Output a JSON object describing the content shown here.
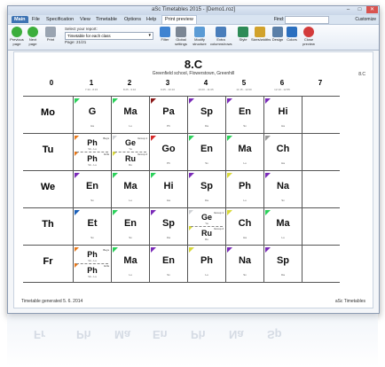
{
  "window": {
    "title": "aSc Timetables 2015 - [Demo1.roz]",
    "controls": [
      "–",
      "□",
      "✕"
    ]
  },
  "menu": {
    "items": [
      "Main",
      "File",
      "Specification",
      "View",
      "Timetable",
      "Options",
      "Help"
    ],
    "active_tab": "Print preview",
    "find_label": "Find:",
    "customize": "Customize"
  },
  "ribbon": {
    "previous": "Previous page",
    "next": "Next page",
    "print": "Print",
    "report_label": "Select your report:",
    "report_value": "Timetable for each class",
    "page_info": "Page: 21/21",
    "filter": "Filter",
    "global_settings": "Global settings",
    "modify_structure": "Modify structure",
    "extra_rows": "Extra columns/rows",
    "style": "Style",
    "sizes": "Sizes/widths",
    "design": "Design",
    "colors": "Colors",
    "close": "Close preview"
  },
  "timetable": {
    "class_name": "8.C",
    "school": "Greenfield school, Flowerstown, Greenhill",
    "right_label": "8.C",
    "periods": [
      "0",
      "1",
      "2",
      "3",
      "4",
      "5",
      "6",
      "7"
    ],
    "period_times": [
      "",
      "7:30 - 8:15",
      "8:25 - 9:10",
      "9:25 - 10:10",
      "10:20 - 11:05",
      "11:15 - 12:00",
      "12:10 - 12:55",
      ""
    ],
    "days": [
      {
        "name": "Mo",
        "cells": [
          {
            "subj": "G",
            "room": "Ha",
            "color": "#2bd15a"
          },
          {
            "subj": "Ma",
            "room": "Lu",
            "color": "#2bd15a"
          },
          {
            "subj": "Pa",
            "room": "Ph",
            "color": "#8b1a1a"
          },
          {
            "subj": "Sp",
            "room": "Da",
            "color": "#7a2ab8"
          },
          {
            "subj": "En",
            "room": "Sv",
            "color": "#7a2ab8"
          },
          {
            "subj": "Hi",
            "room": "Ha",
            "color": "#7a2ab8"
          }
        ]
      },
      {
        "name": "Tu",
        "cells": [
          {
            "split": true,
            "top": {
              "subj": "Ph",
              "room": "Vk - Lu",
              "group": "Boys",
              "color": "#e8781a"
            },
            "bottom": {
              "subj": "Ph",
              "room": "Vk - Lu",
              "group": "Girls",
              "color": "#e8781a"
            }
          },
          {
            "split": true,
            "top": {
              "subj": "Ge",
              "room": "Ya",
              "group": "Group 1",
              "color": "#cfd2d6"
            },
            "bottom": {
              "subj": "Ru",
              "room": "Ru",
              "group": "Group 2",
              "color": "#d9d93a"
            }
          },
          {
            "subj": "Go",
            "room": "Ph",
            "color": "#d62a2a"
          },
          {
            "subj": "En",
            "room": "Sv",
            "color": "#2bd15a"
          },
          {
            "subj": "Ma",
            "room": "Lu",
            "color": "#2bd15a"
          },
          {
            "subj": "Ch",
            "room": "Ha",
            "color": "#9a9a9a"
          }
        ]
      },
      {
        "name": "We",
        "cells": [
          {
            "subj": "En",
            "room": "Sv",
            "color": "#7a2ab8"
          },
          {
            "subj": "Ma",
            "room": "Lu",
            "color": "#2bd15a"
          },
          {
            "subj": "Hi",
            "room": "Ha",
            "color": "#2bd15a"
          },
          {
            "subj": "Sp",
            "room": "Da",
            "color": "#7a2ab8"
          },
          {
            "subj": "Ph",
            "room": "Lu",
            "color": "#d9d93a"
          },
          {
            "subj": "Na",
            "room": "Sv",
            "color": "#7a2ab8"
          }
        ]
      },
      {
        "name": "Th",
        "cells": [
          {
            "subj": "Et",
            "room": "Sv",
            "color": "#1a5fb8"
          },
          {
            "subj": "En",
            "room": "Sv",
            "color": "#2bd15a"
          },
          {
            "subj": "Sp",
            "room": "Da",
            "color": "#7a2ab8"
          },
          {
            "split": true,
            "top": {
              "subj": "Ge",
              "room": "Ya",
              "group": "Group 1",
              "color": "#cfd2d6"
            },
            "bottom": {
              "subj": "Ru",
              "room": "Ru",
              "group": "Group 2",
              "color": "#d9d93a"
            }
          },
          {
            "subj": "Ch",
            "room": "Ha",
            "color": "#d9d93a"
          },
          {
            "subj": "Ma",
            "room": "Lu",
            "color": "#2bd15a"
          }
        ]
      },
      {
        "name": "Fr",
        "cells": [
          {
            "split": true,
            "top": {
              "subj": "Ph",
              "room": "Vk - Lu",
              "group": "Boys",
              "color": "#e8781a"
            },
            "bottom": {
              "subj": "Ph",
              "room": "Vk - Lu",
              "group": "Girls",
              "color": "#e8781a"
            }
          },
          {
            "subj": "Ma",
            "room": "Lu",
            "color": "#2bd15a"
          },
          {
            "subj": "En",
            "room": "Sv",
            "color": "#7a2ab8"
          },
          {
            "subj": "Ph",
            "room": "Lu",
            "color": "#d9d93a"
          },
          {
            "subj": "Na",
            "room": "Sv",
            "color": "#7a2ab8"
          },
          {
            "subj": "Sp",
            "room": "Da",
            "color": "#7a2ab8"
          }
        ]
      }
    ],
    "footer_left": "Timetable generated 5. 6. 2014",
    "footer_right": "aSc Timetables"
  }
}
